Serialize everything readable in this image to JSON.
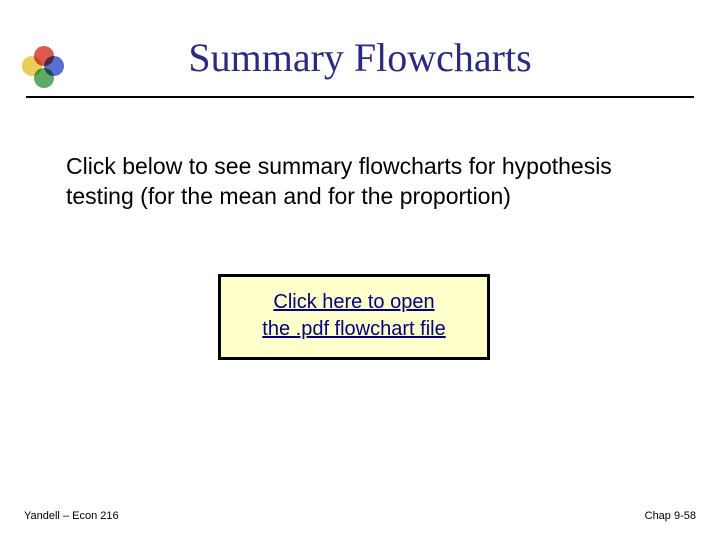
{
  "title": "Summary Flowcharts",
  "body": "Click below to see summary flowcharts for hypothesis testing (for the mean and for the proportion)",
  "link": {
    "line1": "Click here to open",
    "line2": "the .pdf  flowchart file"
  },
  "footer": {
    "left": "Yandell – Econ 216",
    "right": "Chap 9-58"
  }
}
